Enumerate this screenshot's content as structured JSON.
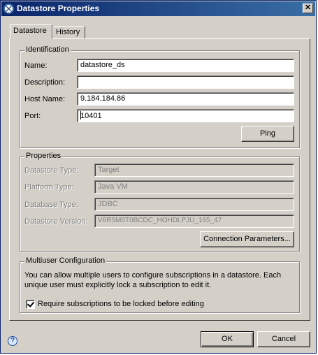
{
  "window": {
    "title": "Datastore Properties",
    "close_glyph": "✕"
  },
  "tabs": [
    {
      "label": "Datastore",
      "active": true
    },
    {
      "label": "History",
      "active": false
    }
  ],
  "identification": {
    "group_title": "Identification",
    "name_label": "Name:",
    "name_value": "datastore_ds",
    "description_label": "Description:",
    "description_value": "",
    "host_label": "Host Name:",
    "host_value": "9.184.184.86",
    "port_label": "Port:",
    "port_value": "10401",
    "ping_button": "Ping"
  },
  "properties": {
    "group_title": "Properties",
    "datastore_type_label": "Datastore Type:",
    "datastore_type_value": "Target",
    "platform_type_label": "Platform Type:",
    "platform_type_value": "Java VM",
    "database_type_label": "Database Type:",
    "database_type_value": "JDBC",
    "datastore_version_label": "Datastore Version:",
    "datastore_version_value": "V6R5M0T0BCDC_HOHDLPJU_165_47",
    "connection_button": "Connection Parameters..."
  },
  "multiuser": {
    "group_title": "Multiuser Configuration",
    "description": "You can allow multiple users to configure subscriptions in a datastore. Each unique user must explicitly lock a subscription to edit it.",
    "checkbox_label": "Require subscriptions to be locked before editing",
    "checkbox_checked": true
  },
  "footer": {
    "ok_button": "OK",
    "cancel_button": "Cancel",
    "help_glyph": "?"
  },
  "colors": {
    "title_bar_start": "#0a246a",
    "title_bar_end": "#3a6ea5",
    "dialog_face": "#d4d0c8",
    "disabled_text": "#808080"
  }
}
